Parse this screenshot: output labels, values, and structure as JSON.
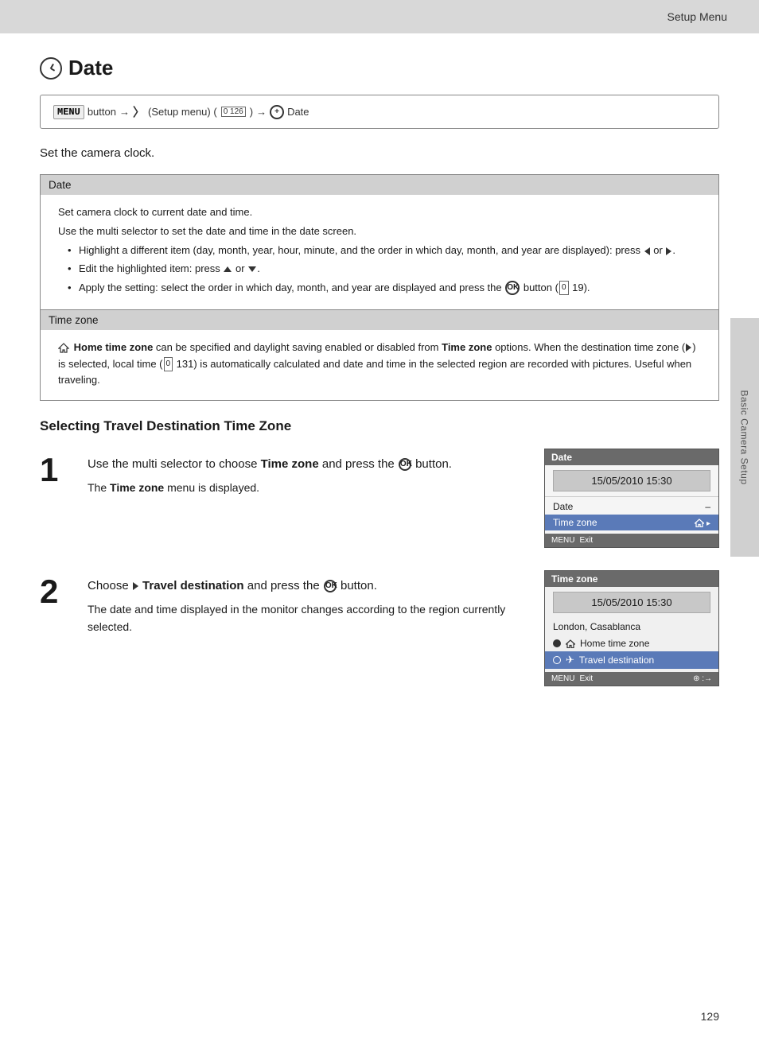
{
  "header": {
    "title": "Setup Menu"
  },
  "page_title": "Date",
  "nav_box": {
    "menu_key": "MENU",
    "text1": "button",
    "arrow1": "→",
    "setup_icon": "Y",
    "text2": "(Setup menu) (",
    "ref": "126",
    "text3": ")",
    "arrow2": "→",
    "date_icon": "⊕",
    "text4": "Date"
  },
  "intro_text": "Set the camera clock.",
  "sections": [
    {
      "header": "Date",
      "content_lines": [
        "Set camera clock to current date and time.",
        "Use the multi selector to set the date and time in the date screen."
      ],
      "bullets": [
        "Highlight a different item (day, month, year, hour, minute, and the order in which day, month, and year are displayed): press ◀ or ▶.",
        "Edit the highlighted item: press ▲ or ▼.",
        "Apply the setting: select the order in which day, month, and year are displayed and press the ⊛ button (□□ 19)."
      ]
    },
    {
      "header": "Time zone",
      "content": "Home time zone can be specified and daylight saving enabled or disabled from Time zone options. When the destination time zone (▶) is selected, local time (□□ 131) is automatically calculated and date and time in the selected region are recorded with pictures. Useful when traveling."
    }
  ],
  "subsection_heading": "Selecting Travel Destination Time Zone",
  "steps": [
    {
      "number": "1",
      "main_text": "Use the multi selector to choose Time zone and press the ⊛ button.",
      "detail_text": "The Time zone menu is displayed.",
      "screen1": {
        "header": "Date",
        "time": "15/05/2010 15:30",
        "rows": [
          {
            "label": "Date",
            "value": "–",
            "highlighted": false
          },
          {
            "label": "Time zone",
            "value": "⌂ ▸",
            "highlighted": true
          }
        ],
        "footer": "MENU Exit"
      }
    },
    {
      "number": "2",
      "main_text": "Choose ▶ Travel destination and press the ⊛ button.",
      "detail_text": "The date and time displayed in the monitor changes according to the region currently selected.",
      "screen2": {
        "header": "Time zone",
        "time": "15/05/2010 15:30",
        "city": "London, Casablanca",
        "options": [
          {
            "radio": "filled",
            "icon": "home",
            "label": "Home time zone",
            "highlighted": false
          },
          {
            "radio": "empty",
            "icon": "plane",
            "label": "Travel destination",
            "highlighted": true
          }
        ],
        "footer_left": "MENU Exit",
        "footer_right": "⊛ :→"
      }
    }
  ],
  "sidebar_label": "Basic Camera Setup",
  "page_number": "129"
}
